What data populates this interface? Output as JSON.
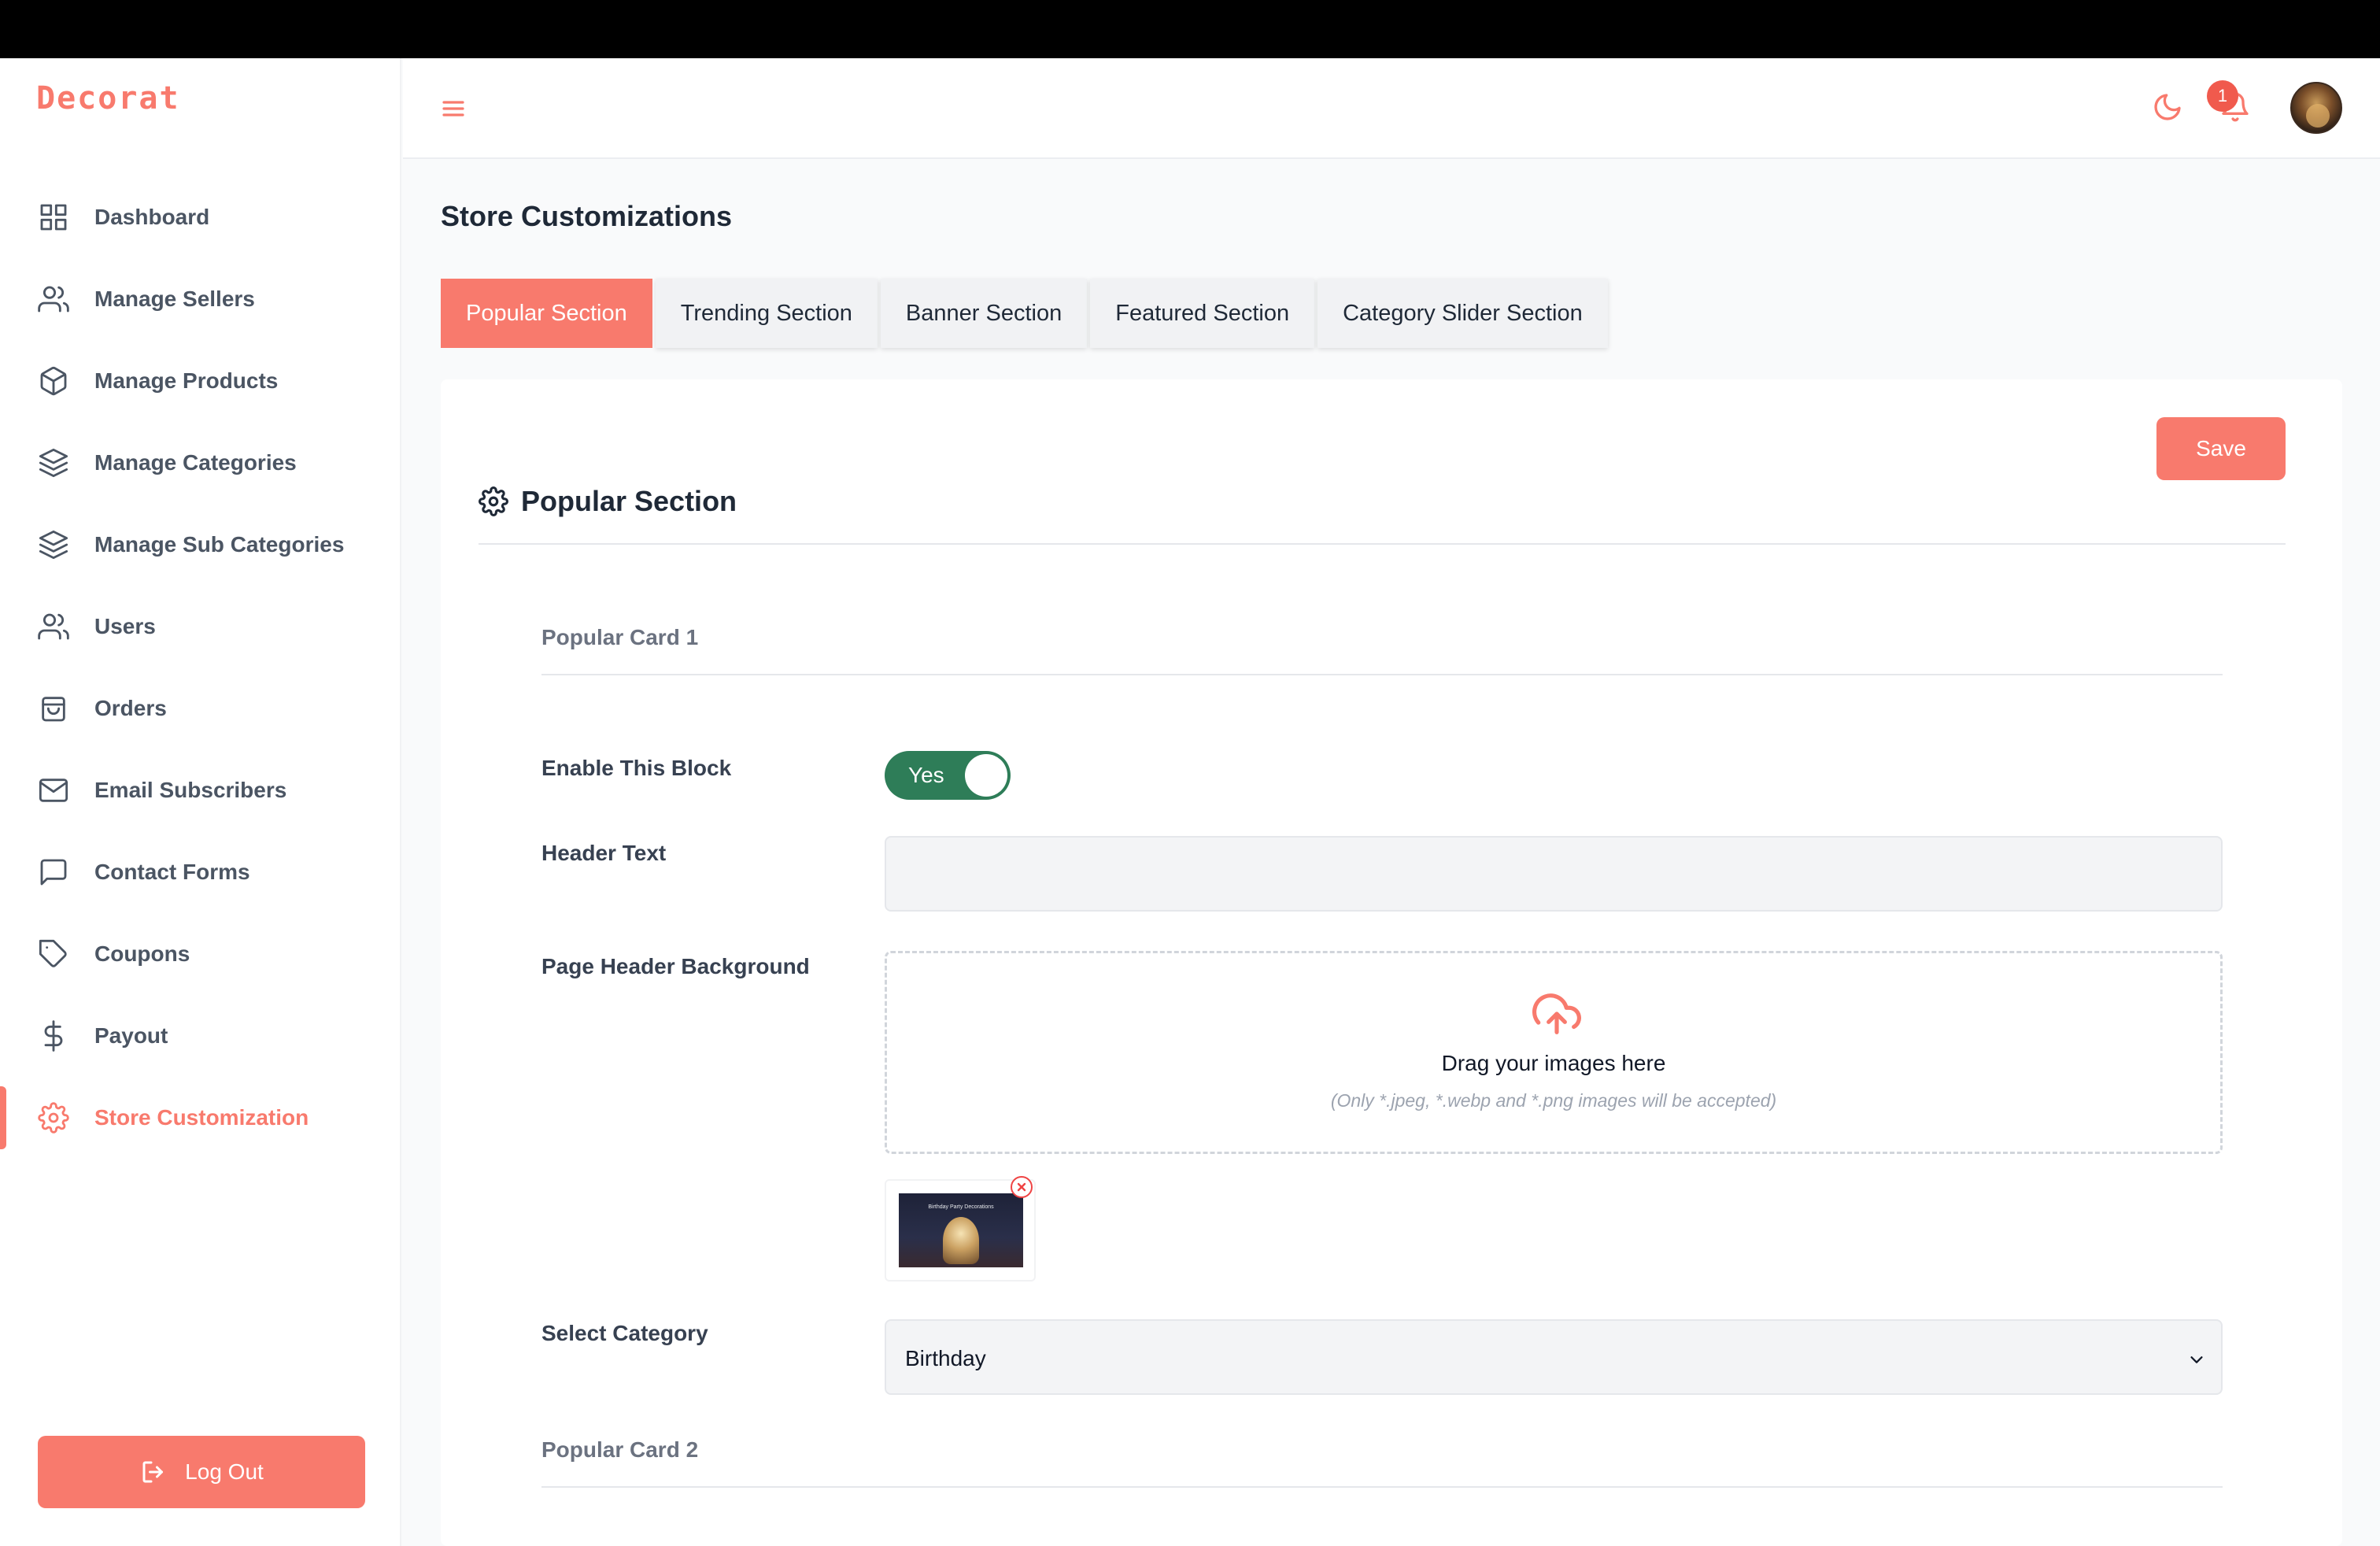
{
  "app": {
    "logo": "Decorat"
  },
  "sidebar": {
    "items": [
      {
        "label": "Dashboard",
        "icon": "grid-icon"
      },
      {
        "label": "Manage Sellers",
        "icon": "users-icon"
      },
      {
        "label": "Manage Products",
        "icon": "box-icon"
      },
      {
        "label": "Manage Categories",
        "icon": "layers-icon"
      },
      {
        "label": "Manage Sub Categories",
        "icon": "layers-icon"
      },
      {
        "label": "Users",
        "icon": "users-icon"
      },
      {
        "label": "Orders",
        "icon": "shopping-bag-icon"
      },
      {
        "label": "Email Subscribers",
        "icon": "mail-icon"
      },
      {
        "label": "Contact Forms",
        "icon": "message-square-icon"
      },
      {
        "label": "Coupons",
        "icon": "tag-icon"
      },
      {
        "label": "Payout",
        "icon": "dollar-icon"
      },
      {
        "label": "Store Customization",
        "icon": "gear-icon",
        "active": true
      }
    ],
    "logout_label": "Log Out"
  },
  "header": {
    "notification_count": "1"
  },
  "main": {
    "title": "Store Customizations",
    "tabs": [
      {
        "label": "Popular Section",
        "active": true
      },
      {
        "label": "Trending Section"
      },
      {
        "label": "Banner Section"
      },
      {
        "label": "Featured Section"
      },
      {
        "label": "Category Slider Section"
      }
    ],
    "save_label": "Save",
    "section_title": "Popular Section",
    "card1": {
      "heading": "Popular Card 1",
      "enable_label": "Enable This Block",
      "toggle_text": "Yes",
      "toggle_on": true,
      "header_text_label": "Header Text",
      "header_text_value": "",
      "background_label": "Page Header Background",
      "dropzone_title": "Drag your images here",
      "dropzone_hint": "(Only *.jpeg, *.webp and *.png images will be accepted)",
      "thumbnail_caption": "Birthday Party Decorations",
      "category_label": "Select Category",
      "category_value": "Birthday"
    },
    "card2": {
      "heading": "Popular Card 2"
    }
  },
  "colors": {
    "accent": "#f87a6d",
    "toggle_on": "#2e7d58",
    "text_dark": "#1f2937",
    "text_muted": "#6b7280"
  }
}
